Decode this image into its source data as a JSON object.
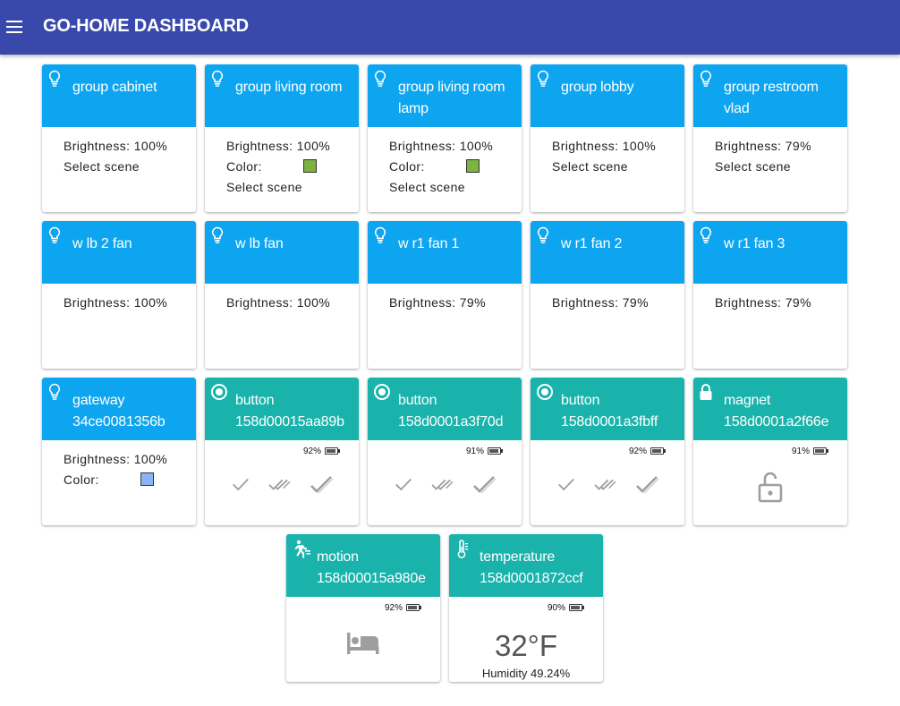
{
  "appbar": {
    "title": "GO-HOME DASHBOARD"
  },
  "cards": {
    "c0": {
      "title": "group cabinet",
      "brightness": "Brightness: 100%",
      "scene": "Select scene"
    },
    "c1": {
      "title": "group living room",
      "brightness": "Brightness: 100%",
      "color_label": "Color:",
      "color": "#7cb342",
      "scene": "Select scene"
    },
    "c2": {
      "title": "group living room lamp",
      "brightness": "Brightness: 100%",
      "color_label": "Color:",
      "color": "#7cb342",
      "scene": "Select scene"
    },
    "c3": {
      "title": "group lobby",
      "brightness": "Brightness: 100%",
      "scene": "Select scene"
    },
    "c4": {
      "title": "group restroom vlad",
      "brightness": "Brightness: 79%",
      "scene": "Select scene"
    },
    "c5": {
      "title": "w lb 2 fan",
      "brightness": "Brightness: 100%"
    },
    "c6": {
      "title": "w lb fan",
      "brightness": "Brightness: 100%"
    },
    "c7": {
      "title": "w r1 fan 1",
      "brightness": "Brightness: 79%"
    },
    "c8": {
      "title": "w r1 fan 2",
      "brightness": "Brightness: 79%"
    },
    "c9": {
      "title": "w r1 fan 3",
      "brightness": "Brightness: 79%"
    },
    "c10": {
      "title": "gateway 34ce0081356b",
      "brightness": "Brightness: 100%",
      "color_label": "Color:",
      "color": "#8ab4f8"
    },
    "c11": {
      "title": "button 158d00015aa89b",
      "battery": "92%",
      "battery_level": 0.92
    },
    "c12": {
      "title": "button 158d0001a3f70d",
      "battery": "91%",
      "battery_level": 0.91
    },
    "c13": {
      "title": "button 158d0001a3fbff",
      "battery": "92%",
      "battery_level": 0.92
    },
    "c14": {
      "title": "magnet 158d0001a2f66e",
      "battery": "91%",
      "battery_level": 0.91
    },
    "c15": {
      "title": "motion 158d00015a980e",
      "battery": "92%",
      "battery_level": 0.92
    },
    "c16": {
      "title": "temperature 158d0001872ccf",
      "battery": "90%",
      "battery_level": 0.9,
      "temperature": "32°F",
      "humidity": "Humidity 49.24%"
    }
  },
  "colors": {
    "appbar": "#3949ab",
    "light_header": "#0ea5f0",
    "sensor_header": "#1ab3ac",
    "icon_gray": "#9e9e9e"
  },
  "icons": {
    "light": "lightbulb-icon",
    "button": "radio-button-icon",
    "magnet": "lock-icon",
    "motion": "motion-sensor-icon",
    "temperature": "thermometer-icon",
    "actions": [
      "check-icon",
      "double-check-icon",
      "long-press-check-icon"
    ],
    "magnet_state": "lock-open-icon",
    "motion_state": "bed-icon"
  }
}
